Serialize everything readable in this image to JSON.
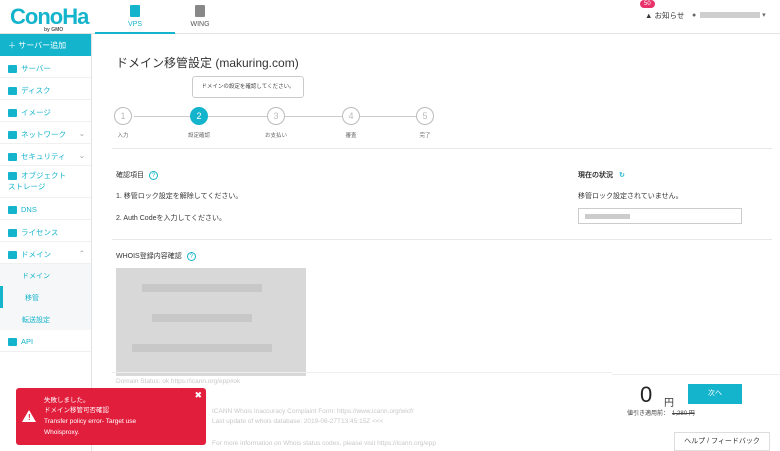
{
  "header": {
    "logo": "ConoHa",
    "logo_sub": "by GMO",
    "tabs": [
      {
        "label": "VPS"
      },
      {
        "label": "WING"
      }
    ],
    "notice_badge": "50",
    "notice_label": "お知らせ"
  },
  "sidebar": {
    "add_label": "サーバー追加",
    "items": [
      {
        "label": "サーバー"
      },
      {
        "label": "ディスク"
      },
      {
        "label": "イメージ"
      },
      {
        "label": "ネットワーク"
      },
      {
        "label": "セキュリティ"
      },
      {
        "label": "オブジェクト\nストレージ"
      },
      {
        "label": "DNS"
      },
      {
        "label": "ライセンス"
      },
      {
        "label": "ドメイン"
      }
    ],
    "subitems": [
      {
        "label": "ドメイン"
      },
      {
        "label": "移管"
      },
      {
        "label": "転送設定"
      }
    ],
    "api": "API"
  },
  "page": {
    "title": "ドメイン移管設定 (makuring.com)",
    "tip": "ドメインの設定を確認してください。",
    "steps": [
      {
        "num": "1",
        "label": "入力"
      },
      {
        "num": "2",
        "label": "設定確認"
      },
      {
        "num": "3",
        "label": "お支払い"
      },
      {
        "num": "4",
        "label": "審査"
      },
      {
        "num": "5",
        "label": "完了"
      }
    ]
  },
  "check": {
    "header": "確認項目",
    "item1": "1. 移管ロック設定を解除してください。",
    "item2": "2. Auth Codeを入力してください。",
    "status_header": "現在の状況",
    "status_text": "移管ロック設定されていません。"
  },
  "whois": {
    "title": "WHOIS登録内容確認",
    "faint1": "Domain Status: ok https://icann.org/epp#ok",
    "faint2": "ICANN Whois Inaccuracy Complaint Form: https://www.icann.org/wicf/",
    "faint3": "Last update of whois database: 2019-06-27T13:45:15Z <<<",
    "faint4": "For more information on Whois status codes, please visit https://icann.org/epp"
  },
  "order": {
    "price": "0",
    "yen": "円",
    "discount_label": "値引き適用前：",
    "old_price": "1,280 円",
    "next": "次へ"
  },
  "help": "ヘルプ / フィードバック",
  "error": {
    "l1": "失敗しました。",
    "l2": "ドメイン移管可否確認",
    "l3": "Transfer policy error- Target use",
    "l4": "Whoisproxy."
  },
  "colors": {
    "accent": "#14b4cc",
    "error": "#e21e3d"
  }
}
